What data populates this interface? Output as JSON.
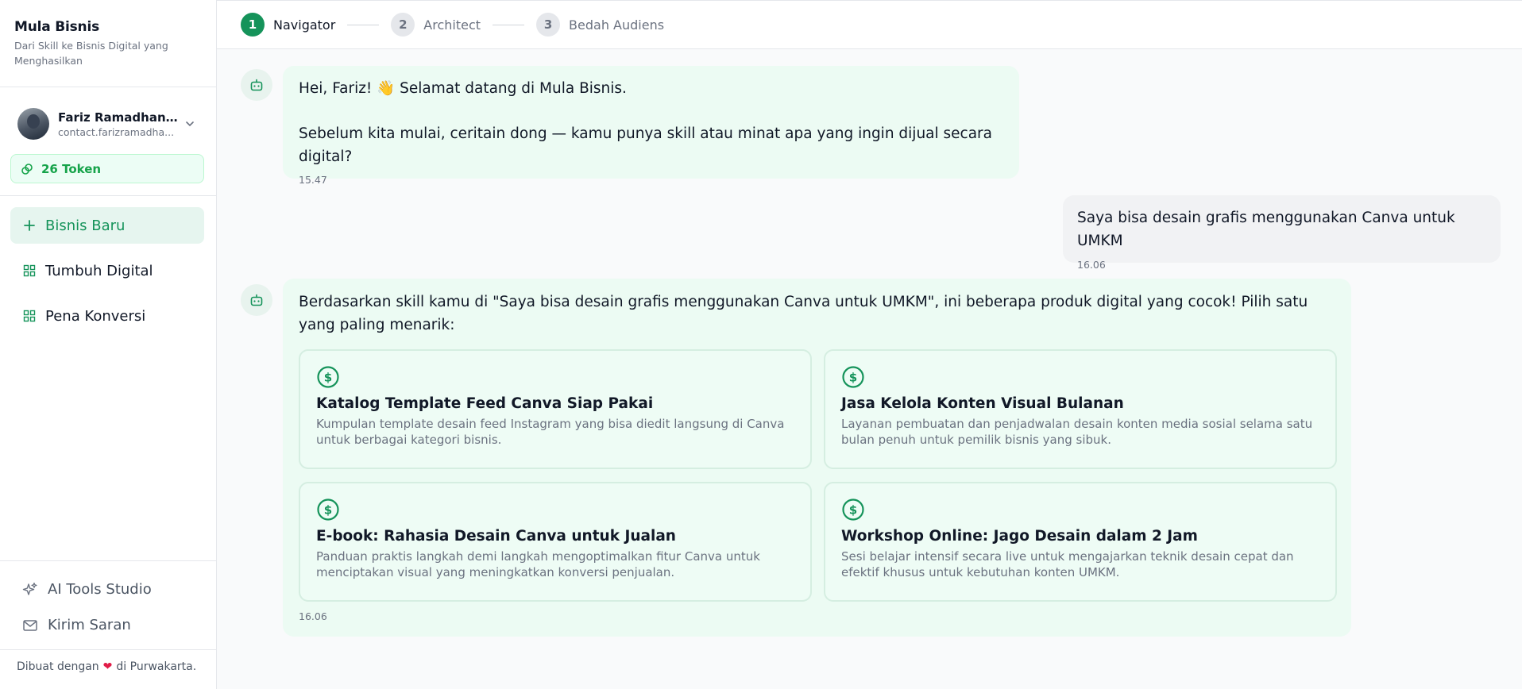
{
  "brand": {
    "title": "Mula Bisnis",
    "subtitle": "Dari Skill ke Bisnis Digital yang Menghasilkan"
  },
  "user": {
    "name": "Fariz Ramadhan (...",
    "email": "contact.farizramadha..."
  },
  "token": {
    "label": "26 Token"
  },
  "nav": {
    "new_business": "Bisnis Baru",
    "items": [
      "Tumbuh Digital",
      "Pena Konversi"
    ]
  },
  "bottom_nav": {
    "ai_tools": "AI Tools Studio",
    "feedback": "Kirim Saran"
  },
  "footer": {
    "made_with": "Dibuat dengan",
    "location": "di Purwakarta."
  },
  "steps": [
    {
      "num": "1",
      "label": "Navigator"
    },
    {
      "num": "2",
      "label": "Architect"
    },
    {
      "num": "3",
      "label": "Bedah Audiens"
    }
  ],
  "messages": {
    "greeting": {
      "line1": "Hei, Fariz! 👋 Selamat datang di Mula Bisnis.",
      "line2": "Sebelum kita mulai, ceritain dong — kamu punya skill atau minat apa yang ingin dijual secara digital?",
      "time": "15.47"
    },
    "user_reply": {
      "text": "Saya bisa desain grafis menggunakan Canva untuk UMKM",
      "time": "16.06"
    },
    "suggestions": {
      "intro": "Berdasarkan skill kamu di \"Saya bisa desain grafis menggunakan Canva untuk UMKM\", ini beberapa produk digital yang cocok! Pilih satu yang paling menarik:",
      "time": "16.06",
      "cards": [
        {
          "title": "Katalog Template Feed Canva Siap Pakai",
          "desc": "Kumpulan template desain feed Instagram yang bisa diedit langsung di Canva untuk berbagai kategori bisnis."
        },
        {
          "title": "Jasa Kelola Konten Visual Bulanan",
          "desc": "Layanan pembuatan dan penjadwalan desain konten media sosial selama satu bulan penuh untuk pemilik bisnis yang sibuk."
        },
        {
          "title": "E-book: Rahasia Desain Canva untuk Jualan",
          "desc": "Panduan praktis langkah demi langkah mengoptimalkan fitur Canva untuk menciptakan visual yang meningkatkan konversi penjualan."
        },
        {
          "title": "Workshop Online: Jago Desain dalam 2 Jam",
          "desc": "Sesi belajar intensif secara live untuk mengajarkan teknik desain cepat dan efektif khusus untuk kebutuhan konten UMKM."
        }
      ]
    }
  },
  "colors": {
    "brand_green": "#15935a",
    "bot_bubble": "#ecfbf3",
    "user_bubble": "#f1f2f4"
  }
}
